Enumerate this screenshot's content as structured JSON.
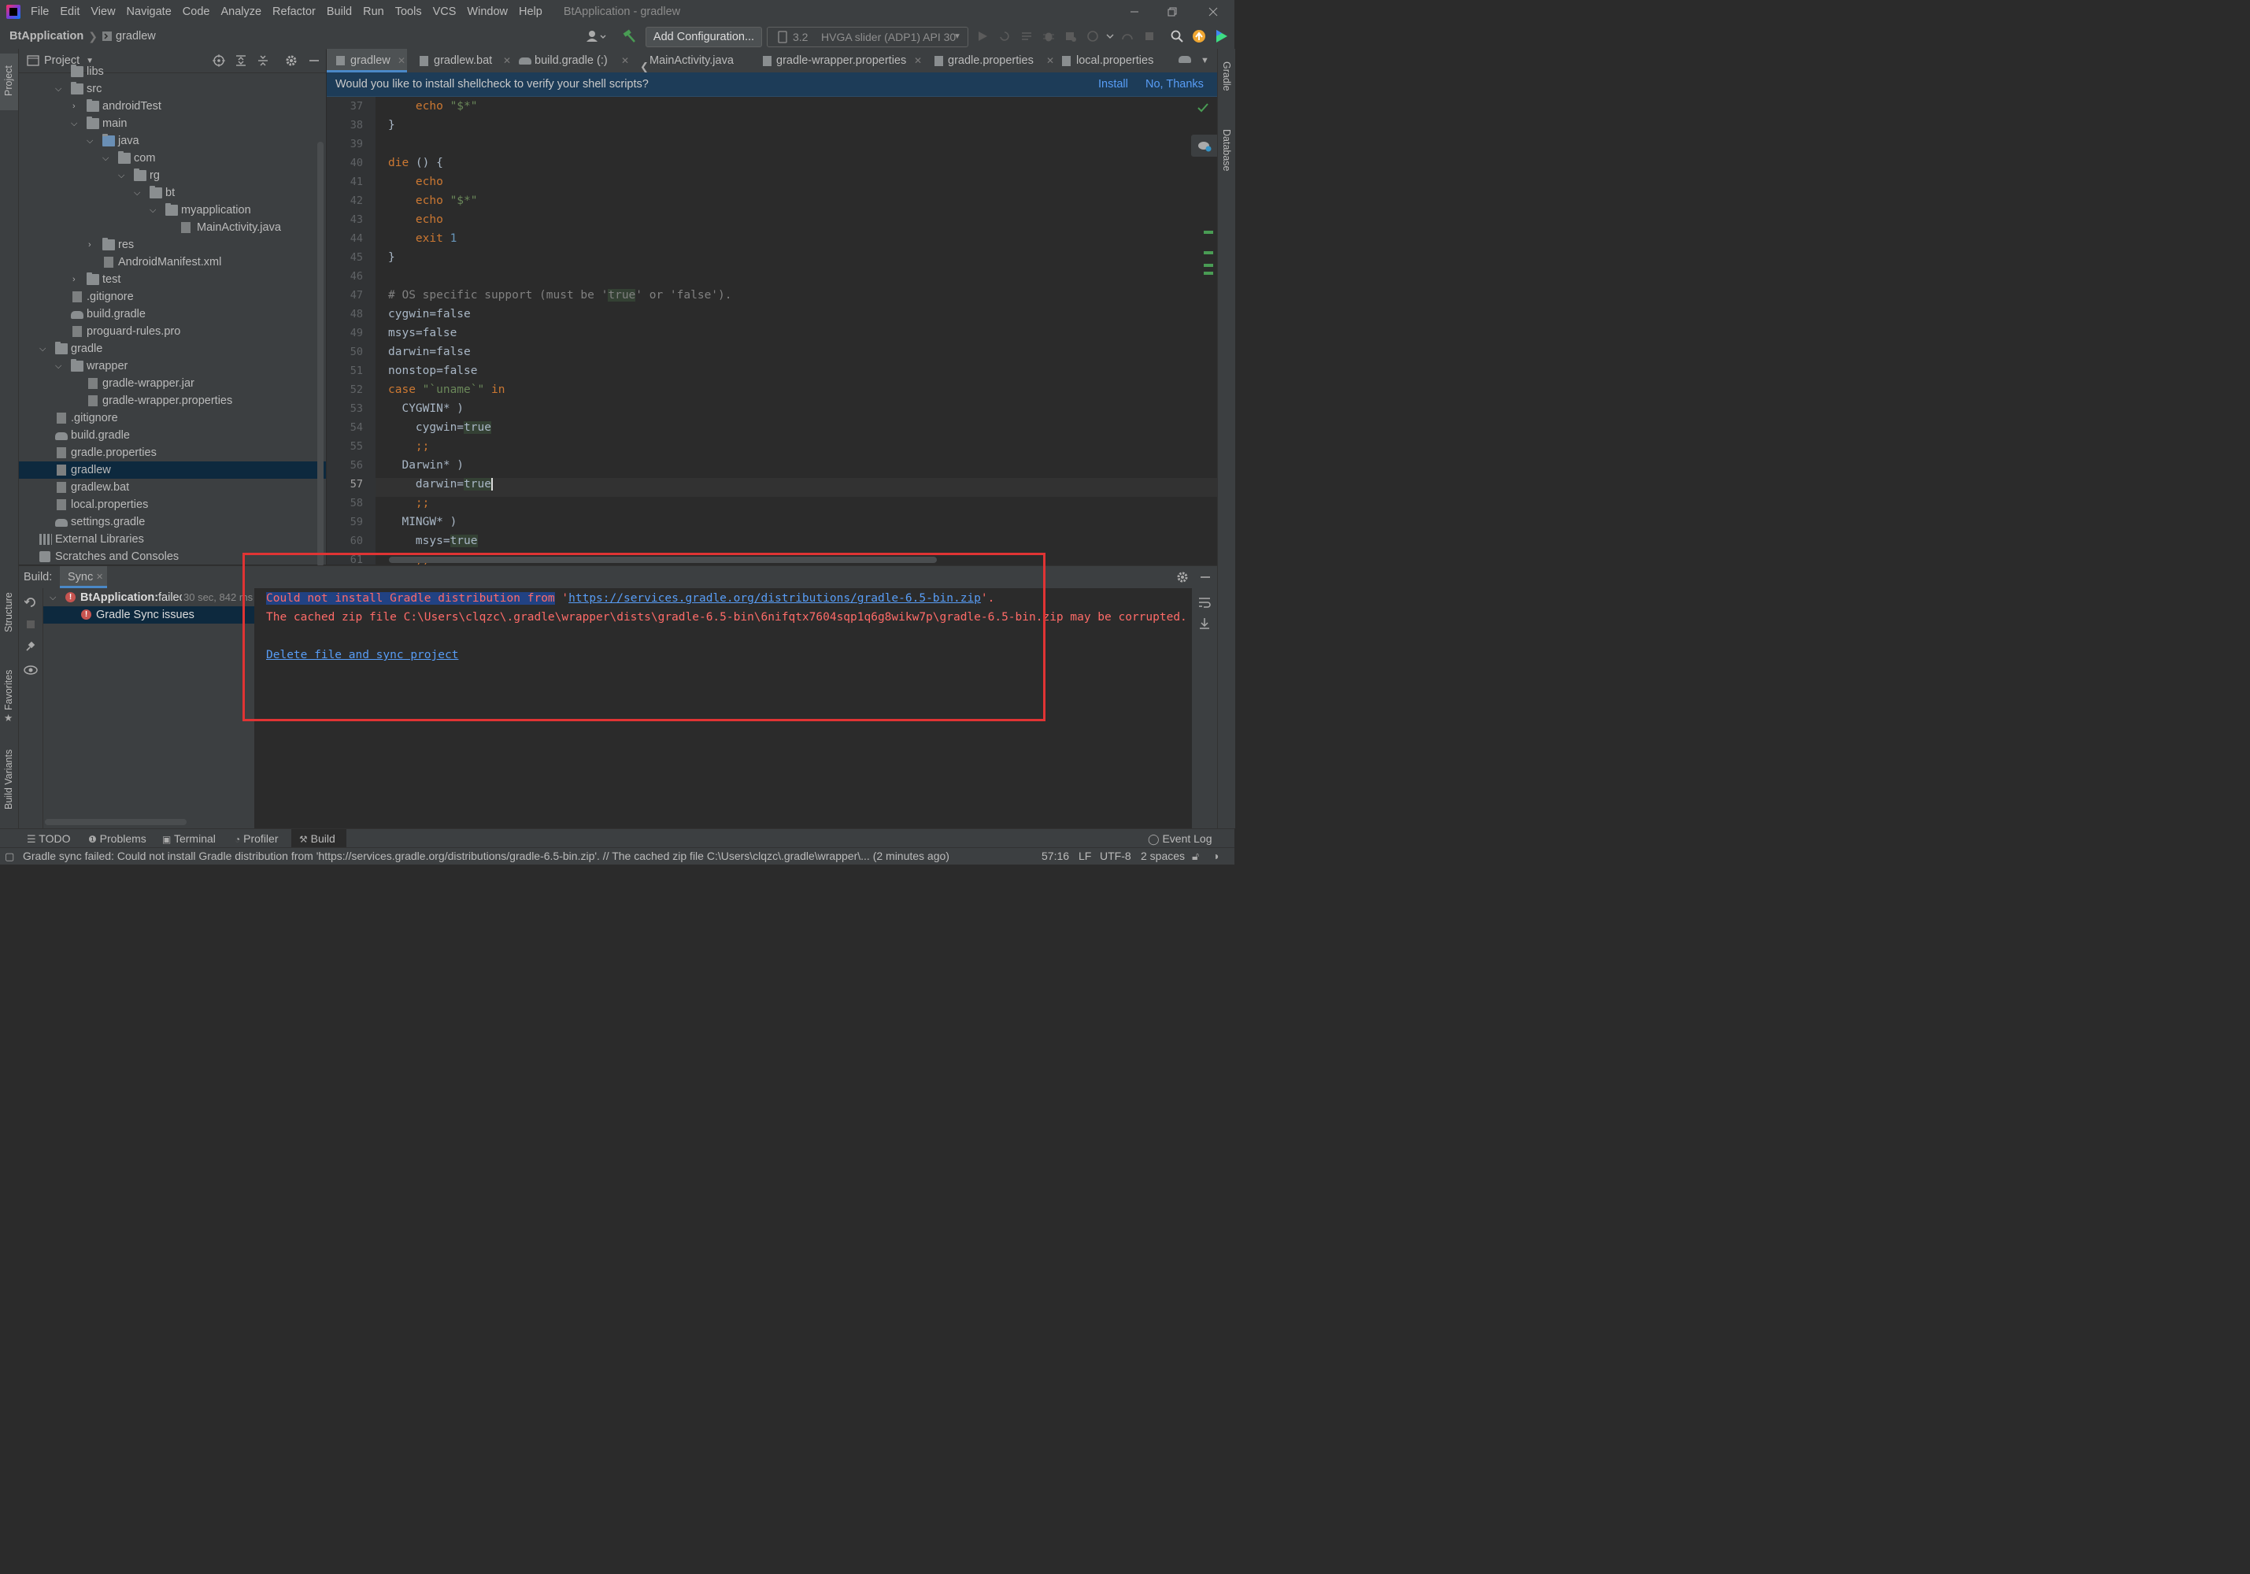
{
  "window": {
    "title": "BtApplication - gradlew"
  },
  "menu": [
    "File",
    "Edit",
    "View",
    "Navigate",
    "Code",
    "Analyze",
    "Refactor",
    "Build",
    "Run",
    "Tools",
    "VCS",
    "Window",
    "Help"
  ],
  "navbar": {
    "project": "BtApplication",
    "file": "gradlew",
    "add_config": "Add Configuration...",
    "device_num": "3.2",
    "device": "HVGA slider (ADP1) API 30"
  },
  "side_tabs": {
    "project": "Project",
    "structure": "Structure",
    "favorites": "Favorites",
    "build_variants": "Build Variants",
    "gradle": "Gradle",
    "database": "Database"
  },
  "project_panel": {
    "title": "Project"
  },
  "tree": [
    {
      "label": "libs"
    },
    {
      "label": "src"
    },
    {
      "label": "androidTest"
    },
    {
      "label": "main"
    },
    {
      "label": "java"
    },
    {
      "label": "com"
    },
    {
      "label": "rg"
    },
    {
      "label": "bt"
    },
    {
      "label": "myapplication"
    },
    {
      "label": "MainActivity.java"
    },
    {
      "label": "res"
    },
    {
      "label": "AndroidManifest.xml"
    },
    {
      "label": "test"
    },
    {
      "label": ".gitignore"
    },
    {
      "label": "build.gradle"
    },
    {
      "label": "proguard-rules.pro"
    },
    {
      "label": "gradle"
    },
    {
      "label": "wrapper"
    },
    {
      "label": "gradle-wrapper.jar"
    },
    {
      "label": "gradle-wrapper.properties"
    },
    {
      "label": ".gitignore"
    },
    {
      "label": "build.gradle"
    },
    {
      "label": "gradle.properties"
    },
    {
      "label": "gradlew"
    },
    {
      "label": "gradlew.bat"
    },
    {
      "label": "local.properties"
    },
    {
      "label": "settings.gradle"
    },
    {
      "label": "External Libraries"
    },
    {
      "label": "Scratches and Consoles"
    }
  ],
  "tabs": [
    {
      "label": "gradlew"
    },
    {
      "label": "gradlew.bat"
    },
    {
      "label": "build.gradle (:)"
    },
    {
      "label": "MainActivity.java"
    },
    {
      "label": "gradle-wrapper.properties"
    },
    {
      "label": "gradle.properties"
    },
    {
      "label": "local.properties"
    }
  ],
  "notification": {
    "text": "Would you like to install shellcheck to verify your shell scripts?",
    "install": "Install",
    "no_thanks": "No, Thanks"
  },
  "editor": {
    "line_numbers": [
      "37",
      "38",
      "39",
      "40",
      "41",
      "42",
      "43",
      "44",
      "45",
      "46",
      "47",
      "48",
      "49",
      "50",
      "51",
      "52",
      "53",
      "54",
      "55",
      "56",
      "57",
      "58",
      "59",
      "60",
      "61"
    ],
    "current_line": "57"
  },
  "build_panel": {
    "label": "Build:",
    "tab": "Sync",
    "root_node": "BtApplication:",
    "root_status": "failed",
    "root_time": "30 sec, 842 ms",
    "child_node": "Gradle Sync issues",
    "output": {
      "line1_selected": "Could not install Gradle distribution from",
      "line1_quote_open": " '",
      "line1_url": "https://services.gradle.org/distributions/gradle-6.5-bin.zip",
      "line1_quote_close": "'.",
      "line2": "The cached zip file C:\\Users\\clqzc\\.gradle\\wrapper\\dists\\gradle-6.5-bin\\6nifqtx7604sqp1q6g8wikw7p\\gradle-6.5-bin.zip may be corrupted.",
      "action_link": "Delete file and sync project"
    }
  },
  "tool_tabs": {
    "todo": "TODO",
    "problems": "Problems",
    "terminal": "Terminal",
    "profiler": "Profiler",
    "build": "Build",
    "event_log": "Event Log"
  },
  "status_bar": {
    "message": "Gradle sync failed: Could not install Gradle distribution from 'https://services.gradle.org/distributions/gradle-6.5-bin.zip'. // The cached zip file C:\\Users\\clqzc\\.gradle\\wrapper\\... (2 minutes ago)",
    "position": "57:16",
    "line_sep": "LF",
    "encoding": "UTF-8",
    "indent": "2 spaces"
  },
  "colors": {
    "accent": "#4a88c7",
    "error": "#ff6b68",
    "link": "#589df6",
    "annotation_box": "#e03434"
  }
}
